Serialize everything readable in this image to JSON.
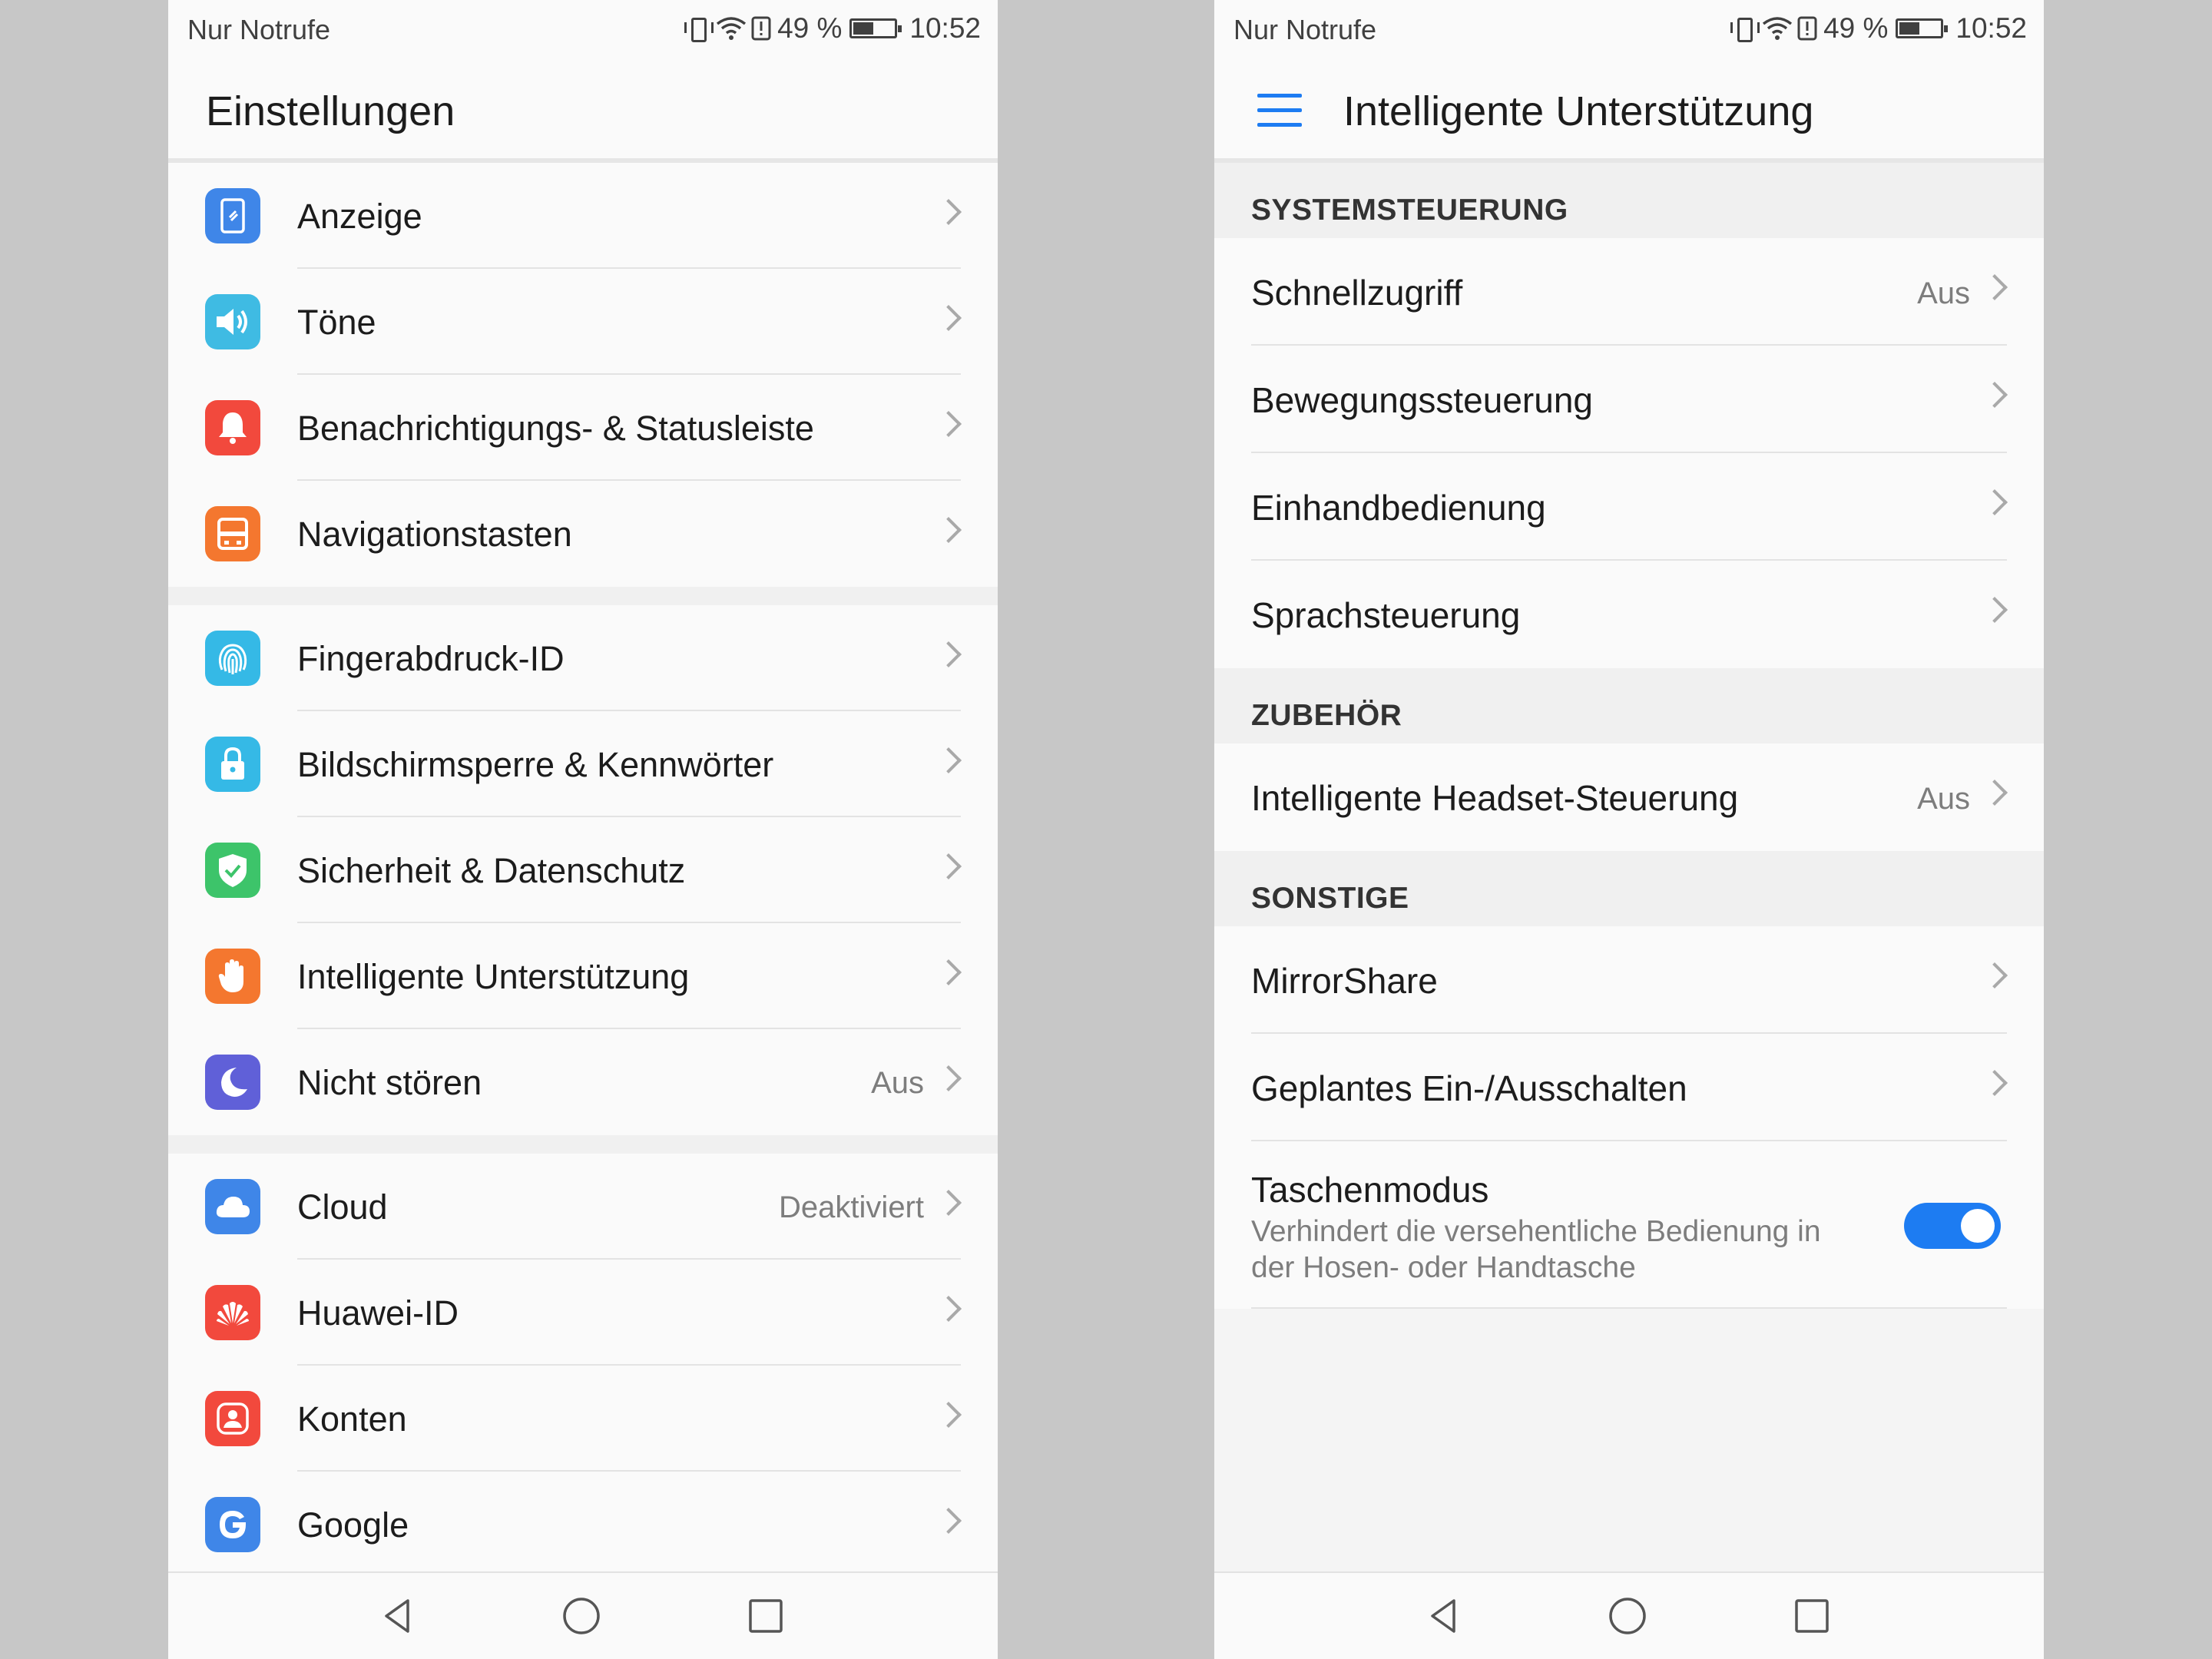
{
  "status": {
    "carrier": "Nur Notrufe",
    "battery": "49 %",
    "time": "10:52"
  },
  "left": {
    "title": "Einstellungen",
    "groups": [
      [
        {
          "label": "Anzeige",
          "icon": "display-icon",
          "color": "#3f86e8"
        },
        {
          "label": "Töne",
          "icon": "speaker-icon",
          "color": "#3fbbe3"
        },
        {
          "label": "Benachrichtigungs- & Statusleiste",
          "icon": "bell-icon",
          "color": "#f2493d"
        },
        {
          "label": "Navigationstasten",
          "icon": "navigation-icon",
          "color": "#f4772f"
        }
      ],
      [
        {
          "label": "Fingerabdruck-ID",
          "icon": "fingerprint-icon",
          "color": "#35b9e6"
        },
        {
          "label": "Bildschirmsperre & Kennwörter",
          "icon": "lock-icon",
          "color": "#35b9e6"
        },
        {
          "label": "Sicherheit & Datenschutz",
          "icon": "shield-icon",
          "color": "#3dc46a"
        },
        {
          "label": "Intelligente Unterstützung",
          "icon": "hand-icon",
          "color": "#f4772f"
        },
        {
          "label": "Nicht stören",
          "icon": "moon-icon",
          "color": "#6060d8",
          "value": "Aus"
        }
      ],
      [
        {
          "label": "Cloud",
          "icon": "cloud-icon",
          "color": "#3f86e8",
          "value": "Deaktiviert"
        },
        {
          "label": "Huawei-ID",
          "icon": "huawei-icon",
          "color": "#f2493d"
        },
        {
          "label": "Konten",
          "icon": "account-icon",
          "color": "#f2493d"
        },
        {
          "label": "Google",
          "icon": "google-icon",
          "color": "#3f86e8"
        }
      ]
    ]
  },
  "right": {
    "title": "Intelligente Unterstützung",
    "sections": [
      {
        "header": "SYSTEMSTEUERUNG",
        "items": [
          {
            "label": "Schnellzugriff",
            "value": "Aus"
          },
          {
            "label": "Bewegungssteuerung"
          },
          {
            "label": "Einhandbedienung"
          },
          {
            "label": "Sprachsteuerung"
          }
        ]
      },
      {
        "header": "ZUBEHÖR",
        "items": [
          {
            "label": "Intelligente Headset-Steuerung",
            "value": "Aus"
          }
        ]
      },
      {
        "header": "SONSTIGE",
        "items": [
          {
            "label": "MirrorShare"
          },
          {
            "label": "Geplantes Ein-/Ausschalten"
          }
        ]
      }
    ],
    "pocket": {
      "label": "Taschenmodus",
      "desc": "Verhindert die versehentliche Bedienung in der Hosen- oder Handtasche",
      "enabled": true
    }
  },
  "colors": {
    "accent": "#1d7cf2"
  }
}
